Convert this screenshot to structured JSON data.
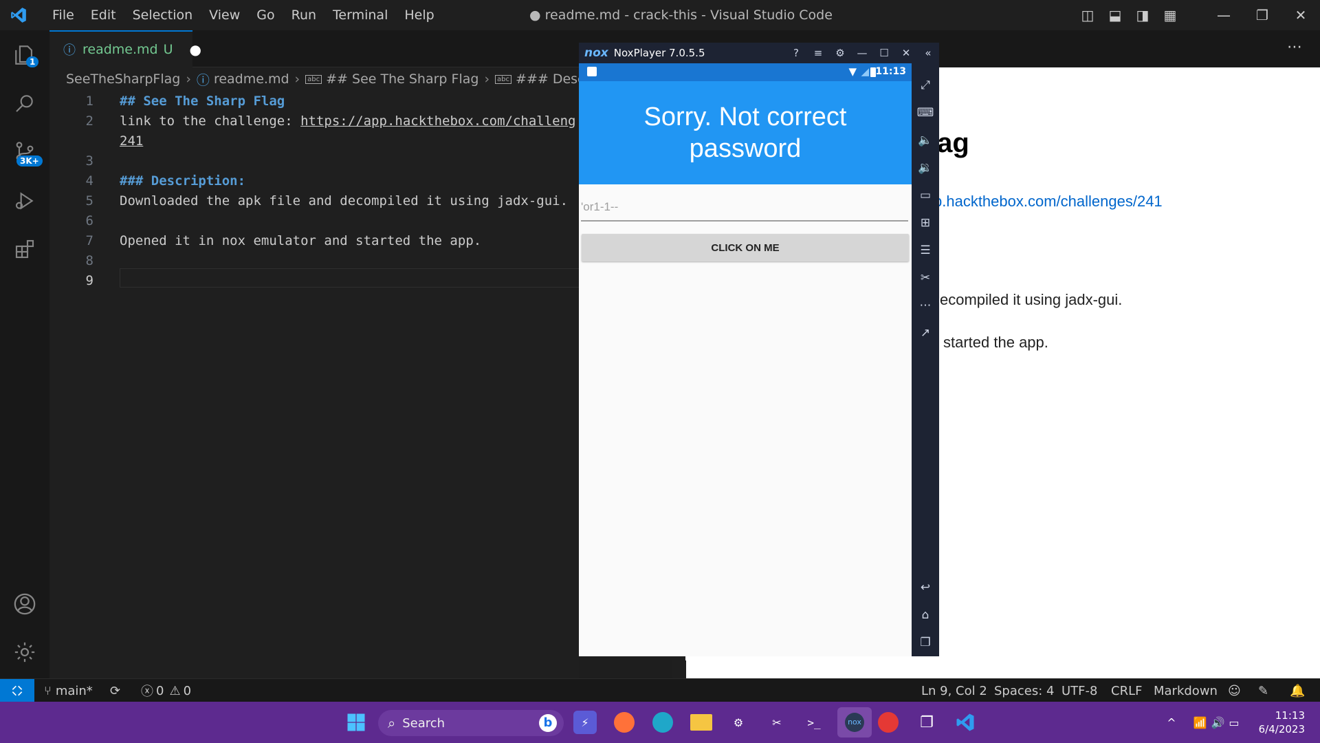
{
  "window": {
    "title": "● readme.md - crack-this - Visual Studio Code",
    "menu": [
      "File",
      "Edit",
      "Selection",
      "View",
      "Go",
      "Run",
      "Terminal",
      "Help"
    ]
  },
  "activity": {
    "explorer_badge": "1",
    "scm_badge": "3K+"
  },
  "editor_tab": {
    "label": "readme.md",
    "status": "U"
  },
  "breadcrumb": [
    "SeeTheSharpFlag",
    "readme.md",
    "## See The Sharp Flag",
    "### Description:"
  ],
  "code_lines": [
    {
      "num": "1",
      "text": "## See The Sharp Flag"
    },
    {
      "num": "2",
      "text": "link to the challenge: ",
      "url": "https://app.hackthebox.com/challeng"
    },
    {
      "num": "",
      "text": "241"
    },
    {
      "num": "3",
      "text": ""
    },
    {
      "num": "4",
      "text": "### Description:"
    },
    {
      "num": "5",
      "text": "Downloaded the apk file and decompiled it using jadx-gui."
    },
    {
      "num": "6",
      "text": ""
    },
    {
      "num": "7",
      "text": "Opened it in nox emulator and started the app."
    },
    {
      "num": "8",
      "text": ""
    },
    {
      "num": "9",
      "text": ""
    }
  ],
  "preview": {
    "heading_fragment": "lag",
    "link_fragment": "p.hackthebox.com/challenges/241",
    "para1_fragment": "ecompiled it using jadx-gui.",
    "para2_fragment": "started the app."
  },
  "nox": {
    "logo": "nox",
    "title": "NoxPlayer 7.0.5.5",
    "status_time": "11:13",
    "app_message": "Sorry. Not correct password",
    "input_value": "'or1-1--",
    "button_label": "CLICK ON ME"
  },
  "statusbar": {
    "branch": "main*",
    "errors": "0",
    "warnings": "0",
    "position": "Ln 9, Col 2",
    "spaces": "Spaces: 4",
    "encoding": "UTF-8",
    "eol": "CRLF",
    "language": "Markdown"
  },
  "taskbar": {
    "search_label": "Search",
    "time": "11:13",
    "date": "6/4/2023"
  },
  "colors": {
    "accent": "#0078d4",
    "app_bar": "#2196f3",
    "taskbar": "#5d2a8f"
  }
}
